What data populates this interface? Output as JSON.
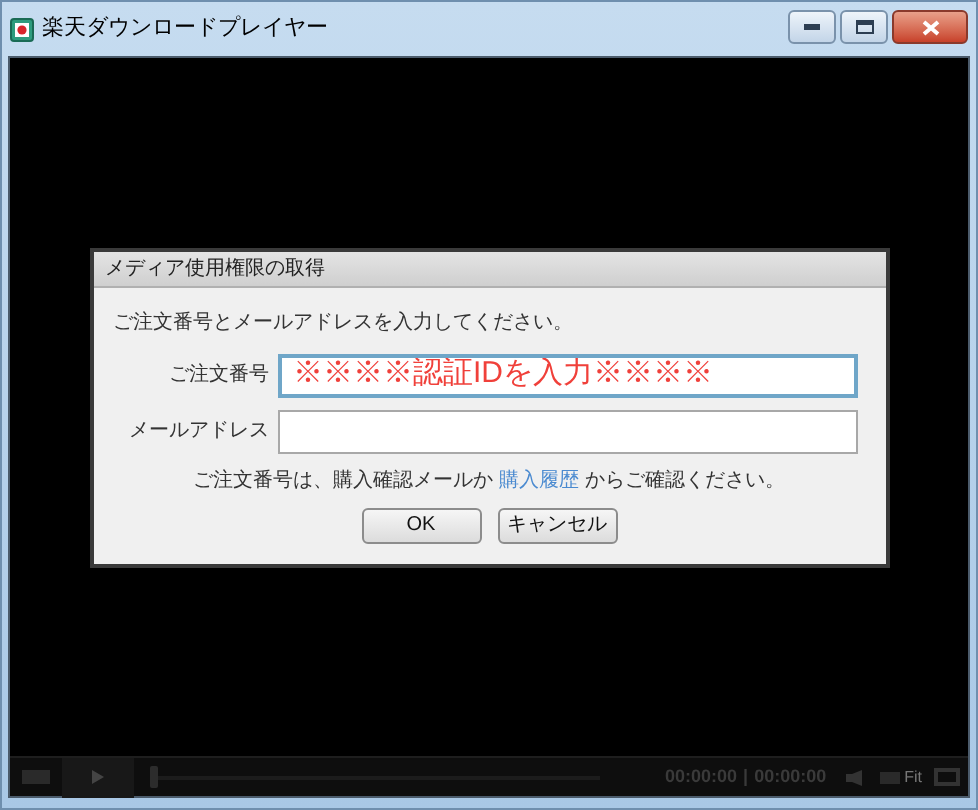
{
  "window": {
    "title": "楽天ダウンロードプレイヤー"
  },
  "dialog": {
    "title": "メディア使用権限の取得",
    "instruction": "ご注文番号とメールアドレスを入力してください。",
    "fields": [
      {
        "label": "ご注文番号",
        "value": "※※※※認証IDを入力※※※※",
        "focused": true
      },
      {
        "label": "メールアドレス",
        "focused": false
      }
    ],
    "note": {
      "before": "ご注文番号は、購入確認メールか",
      "link": "購入履歴",
      "after": "からご確認ください。"
    },
    "buttons": [
      "OK",
      "キャンセル"
    ]
  },
  "player": {
    "seek": {
      "level": 0
    },
    "time_elapsed": "00:00:00",
    "separator": "|",
    "time_total": "00:00:00",
    "fit_label": "Fit"
  }
}
